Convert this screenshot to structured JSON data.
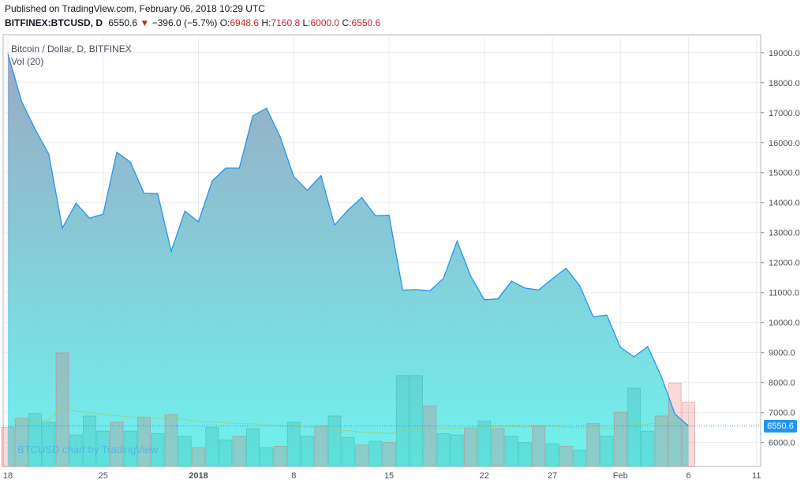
{
  "header": {
    "published": "Published on TradingView.com, February 06, 2018 10:29 UTC",
    "symbol": "BITFINEX:BTCUSD, D",
    "last": "6550.6",
    "change_arrow": "▼",
    "change": "−396.0 (−5.7%)",
    "o_label": "O:",
    "o_value": "6948.6",
    "h_label": "H:",
    "h_value": "7160.8",
    "l_label": "L:",
    "l_value": "6000.0",
    "c_label": "C:",
    "c_value": "6550.6"
  },
  "legend": {
    "title": "Bitcoin / Dollar, D, BITFINEX",
    "volume": "Vol (20)"
  },
  "watermark": "BTCUSD chart by TradingView",
  "price_tag": "6550.6",
  "colors": {
    "line": "#2196f3",
    "area_top": "#9aa9c2",
    "area_bottom": "#6ff2ef",
    "volume_up": "#26a69a",
    "volume_down": "#ef5350",
    "volume_ma": "#9ccc65"
  },
  "chart_data": {
    "type": "area",
    "title": "Bitcoin / Dollar, D, BITFINEX",
    "price_axis": {
      "min": 5200,
      "max": 19600,
      "ticks": [
        6000,
        7000,
        8000,
        9000,
        10000,
        11000,
        12000,
        13000,
        14000,
        15000,
        16000,
        17000,
        18000,
        19000
      ],
      "tick_labels": [
        "6000.0",
        "7000.0",
        "8000.0",
        "9000.0",
        "10000.0",
        "11000.0",
        "12000.0",
        "13000.0",
        "14000.0",
        "15000.0",
        "16000.0",
        "17000.0",
        "18000.0",
        "19000.0"
      ]
    },
    "time_axis": {
      "ticks": [
        {
          "index": 0,
          "label": "18",
          "bold": false
        },
        {
          "index": 7,
          "label": "25",
          "bold": false
        },
        {
          "index": 14,
          "label": "2018",
          "bold": true
        },
        {
          "index": 21,
          "label": "8",
          "bold": false
        },
        {
          "index": 28,
          "label": "15",
          "bold": false
        },
        {
          "index": 35,
          "label": "22",
          "bold": false
        },
        {
          "index": 40,
          "label": "27",
          "bold": false
        },
        {
          "index": 45,
          "label": "Feb",
          "bold": false
        },
        {
          "index": 50,
          "label": "6",
          "bold": false
        },
        {
          "index": 55,
          "label": "11",
          "bold": false
        }
      ]
    },
    "close": [
      18970,
      17380,
      16450,
      15620,
      13150,
      13980,
      13480,
      13620,
      15680,
      15350,
      14310,
      14300,
      12380,
      13720,
      13360,
      14720,
      15150,
      15150,
      16900,
      17150,
      16200,
      14870,
      14410,
      14900,
      13250,
      13760,
      14170,
      13560,
      13580,
      11080,
      11100,
      11060,
      11470,
      12720,
      11550,
      10760,
      10790,
      11380,
      11150,
      11090,
      11460,
      11810,
      11240,
      10190,
      10250,
      9170,
      8860,
      9200,
      8210,
      6950,
      6550
    ],
    "volume_direction": [
      "down",
      "down",
      "up",
      "up",
      "down",
      "up",
      "up",
      "up",
      "down",
      "up",
      "down",
      "up",
      "down",
      "up",
      "down",
      "up",
      "up",
      "down",
      "up",
      "up",
      "down",
      "up",
      "up",
      "down",
      "up",
      "up",
      "down",
      "up",
      "down",
      "up",
      "up",
      "down",
      "up",
      "up",
      "down",
      "up",
      "down",
      "up",
      "up",
      "down",
      "up",
      "down",
      "up",
      "down",
      "up",
      "down",
      "up",
      "up",
      "down",
      "down",
      "down"
    ],
    "volume_relative": [
      0.31,
      0.38,
      0.42,
      0.35,
      0.9,
      0.25,
      0.4,
      0.28,
      0.35,
      0.28,
      0.39,
      0.26,
      0.41,
      0.24,
      0.15,
      0.31,
      0.21,
      0.24,
      0.3,
      0.15,
      0.16,
      0.35,
      0.24,
      0.32,
      0.4,
      0.23,
      0.17,
      0.2,
      0.19,
      0.72,
      0.72,
      0.48,
      0.26,
      0.25,
      0.3,
      0.36,
      0.3,
      0.24,
      0.19,
      0.32,
      0.18,
      0.16,
      0.13,
      0.34,
      0.24,
      0.43,
      0.62,
      0.28,
      0.4,
      0.66,
      0.51
    ]
  }
}
